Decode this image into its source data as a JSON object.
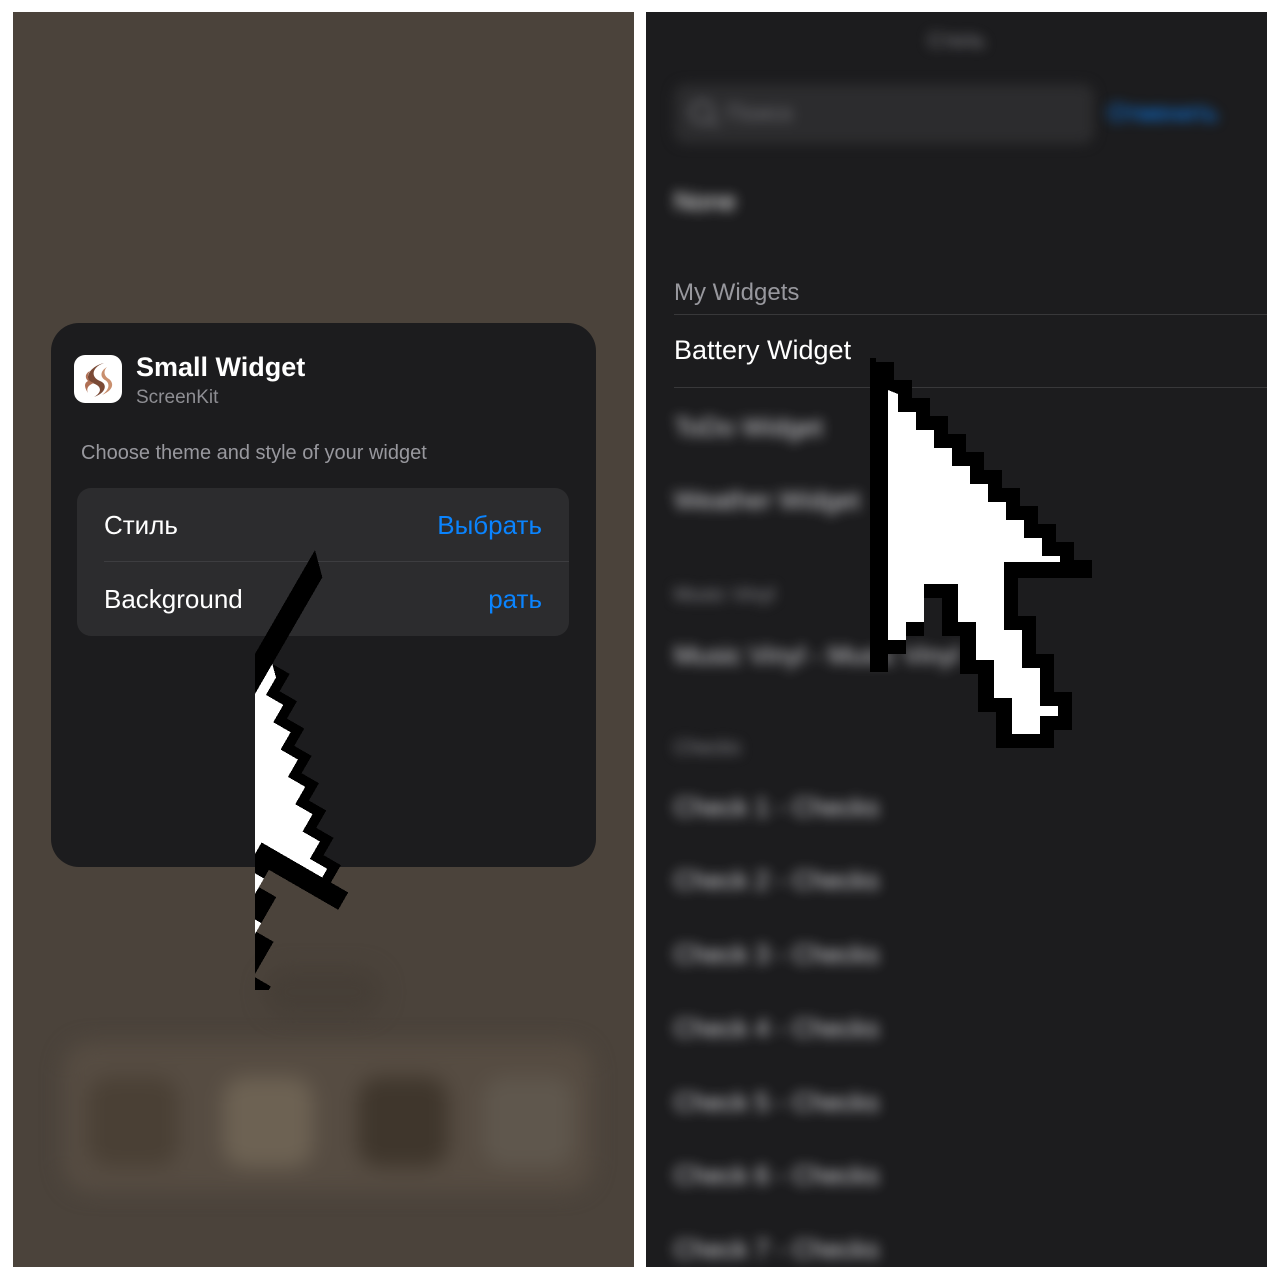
{
  "left_panel": {
    "widget": {
      "title": "Small Widget",
      "app_name": "ScreenKit",
      "description": "Choose theme and style of your widget",
      "rows": [
        {
          "label": "Стиль",
          "value": "Выбрать"
        },
        {
          "label": "Background",
          "value": "рать"
        }
      ]
    }
  },
  "right_panel": {
    "nav_title": "Стиль",
    "search_placeholder": "Поиск",
    "cancel_label": "Отменить",
    "none_label": "None",
    "my_widgets_header": "My Widgets",
    "selected_item": "Battery Widget",
    "blurred_items": [
      "ToDo Widget",
      "Weather Widget"
    ],
    "music_header": "Music Vinyl",
    "music_item": "Music Vinyl - Music Vinyl",
    "checks_header": "Checks",
    "check_items": [
      "Check 1 - Checks",
      "Check 2 - Checks",
      "Check 3 - Checks",
      "Check 4 - Checks",
      "Check 5 - Checks",
      "Check 6 - Checks",
      "Check 7 - Checks"
    ]
  },
  "colors": {
    "accent": "#0a84ff",
    "card": "#1c1c1e",
    "group": "#2c2c2e",
    "backdrop": "#4b433b"
  },
  "icons": [
    "screenkit-app-icon",
    "search-icon",
    "pointer-cursor-icon"
  ]
}
